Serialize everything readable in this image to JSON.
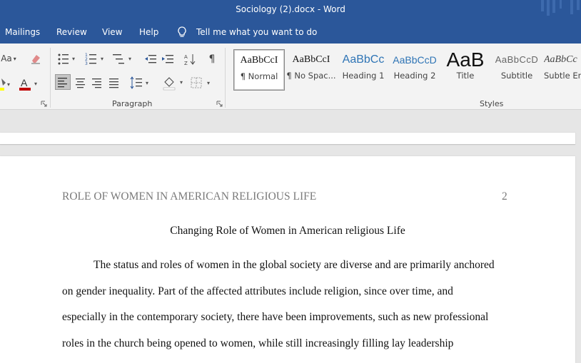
{
  "window": {
    "title": "Sociology (2).docx  -  Word"
  },
  "menu": {
    "items": [
      "Mailings",
      "Review",
      "View",
      "Help"
    ],
    "tell_me": "Tell me what you want to do"
  },
  "ribbon": {
    "font_partial": "Aa",
    "paragraph_label": "Paragraph",
    "styles_label": "Styles",
    "styles": [
      {
        "preview": "AaBbCcI",
        "label": "¶ Normal"
      },
      {
        "preview": "AaBbCcI",
        "label": "¶ No Spac..."
      },
      {
        "preview": "AaBbCc",
        "label": "Heading 1"
      },
      {
        "preview": "AaBbCcD",
        "label": "Heading 2"
      },
      {
        "preview": "AaB",
        "label": "Title"
      },
      {
        "preview": "AaBbCcD",
        "label": "Subtitle"
      },
      {
        "preview": "AaBbCc",
        "label": "Subtle Em"
      }
    ]
  },
  "document": {
    "running_head": "ROLE OF WOMEN IN AMERICAN RELIGIOUS LIFE",
    "page_number": "2",
    "heading": "Changing Role of Women in American religious Life",
    "lines": [
      "The status and roles of women in the global society are diverse and are primarily anchored",
      "on gender inequality. Part of the affected attributes include religion, since over time, and",
      "especially in the contemporary society, there have been improvements, such as new professional",
      "roles in the church being opened to women, while still increasingly filling lay leadership"
    ]
  },
  "colors": {
    "titlebar": "#2b579a",
    "ribbon": "#f3f3f3",
    "font_color_red": "#c00000",
    "highlight_yellow": "#ffff00"
  }
}
